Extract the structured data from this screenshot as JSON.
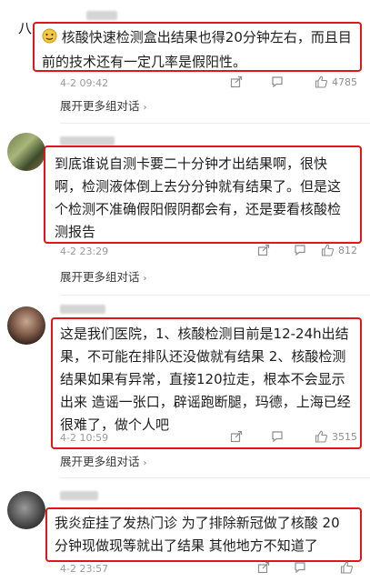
{
  "comments": [
    {
      "text": "核酸快速检测盒出结果也得20分钟左右，而且目前的技术还有一定几率是假阳性。",
      "emoji_icon": "face-emoji-icon",
      "time": "4-2 09:42",
      "likes": "4785",
      "expand": "展开更多组对话"
    },
    {
      "text": "到底谁说自测卡要二十分钟才出结果啊，很快啊，检测液体倒上去分分钟就有结果了。但是这个检测不准确假阳假阴都会有，还是要看核酸检测报告",
      "time": "4-2 23:29",
      "likes": "812",
      "expand": "展开更多组对话"
    },
    {
      "text": "这是我们医院，1、核酸检测目前是12-24h出结果，不可能在排队还没做就有结果 2、核酸检测结果如果有异常，直接120拉走，根本不会显示出来 造谣一张口，辟谣跑断腿，玛德，上海已经很难了，做个人吧",
      "time": "4-2 10:59",
      "likes": "3515",
      "expand": "展开更多组对话"
    },
    {
      "text": "我炎症挂了发热门诊 为了排除新冠做了核酸 20分钟现做现等就出了结果 其他地方不知道了",
      "time": "4-2 23:57",
      "likes": ""
    }
  ],
  "header_symbol": "八",
  "colors": {
    "highlight": "#e3151b",
    "meta": "#9a9a9a",
    "divider": "#ececec"
  }
}
